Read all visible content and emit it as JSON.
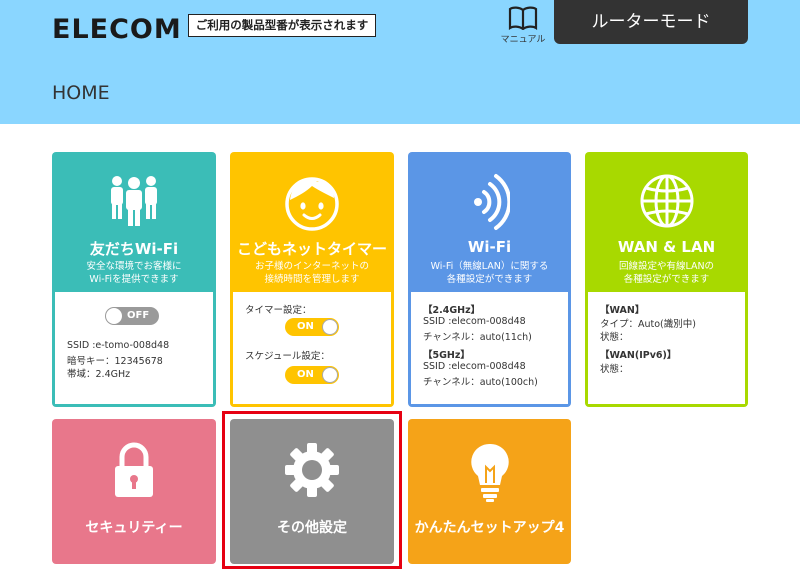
{
  "header": {
    "logo": "ELECOM",
    "model_notice": "ご利用の製品型番が表示されます",
    "manual_label": "マニュアル",
    "mode_button": "ルーターモード",
    "page_title": "HOME",
    "colors": {
      "header_bg": "#8ad6ff",
      "mode_button_bg": "#333333"
    }
  },
  "tiles": {
    "friends_wifi": {
      "name": "友だちWi-Fi",
      "desc1": "安全な環境でお客様に",
      "desc2": "Wi-Fiを提供できます",
      "toggle": "OFF",
      "ssid": "SSID :e-tomo-008d48",
      "key": "暗号キー：12345678",
      "band": "帯域：2.4GHz",
      "icon": "people-icon",
      "color": "#3bbdb7"
    },
    "kids_timer": {
      "name": "こどもネットタイマー",
      "desc1": "お子様のインターネットの",
      "desc2": "接続時間を管理します",
      "timer_label": "タイマー設定：",
      "timer_toggle": "ON",
      "schedule_label": "スケジュール設定：",
      "schedule_toggle": "ON",
      "icon": "child-face-icon",
      "color": "#ffc400"
    },
    "wifi": {
      "name": "Wi-Fi",
      "desc1": "Wi-Fi（無線LAN）に関する",
      "desc2": "各種設定ができます",
      "band24_heading": "【2.4GHz】",
      "band24_ssid": "SSID :elecom-008d48",
      "band24_channel": "チャンネル：auto(11ch)",
      "band5_heading": "【5GHz】",
      "band5_ssid": "SSID :elecom-008d48",
      "band5_channel": "チャンネル：auto(100ch)",
      "icon": "wifi-signal-icon",
      "color": "#5b96e6"
    },
    "wan_lan": {
      "name": "WAN & LAN",
      "desc1": "回線設定や有線LANの",
      "desc2": "各種設定ができます",
      "wan_heading": "【WAN】",
      "wan_type": "タイプ：Auto(識別中)",
      "wan_status": "状態：",
      "ipv6_heading": "【WAN(IPv6)】",
      "ipv6_status": "状態：",
      "icon": "globe-icon",
      "color": "#a8d900"
    },
    "security": {
      "name": "セキュリティー",
      "icon": "lock-icon",
      "color": "#e8778b"
    },
    "other_settings": {
      "name": "その他設定",
      "icon": "gear-icon",
      "color": "#8f8f8f"
    },
    "easy_setup": {
      "name": "かんたんセットアップ4",
      "icon": "lightbulb-icon",
      "color": "#f5a318"
    }
  },
  "highlight_color": "#e60012"
}
